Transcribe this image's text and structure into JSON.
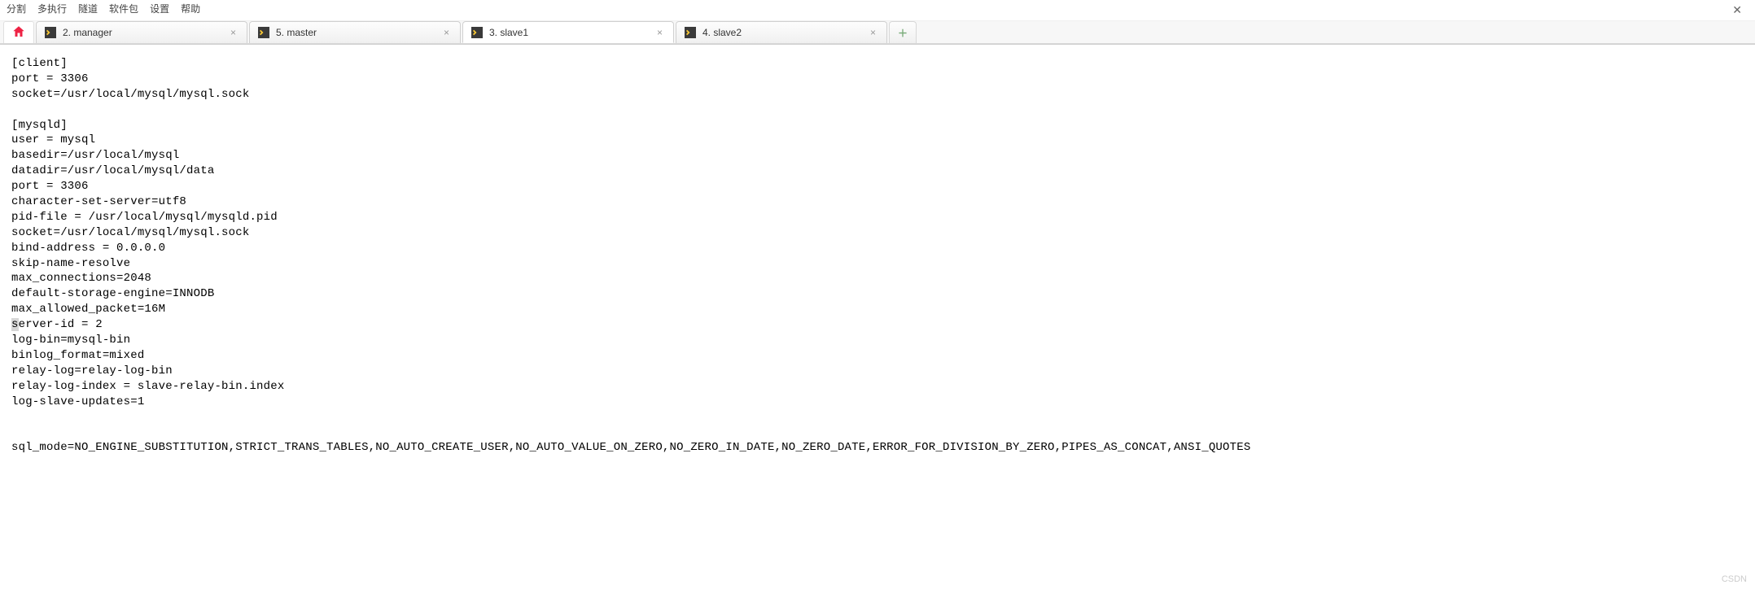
{
  "menu": {
    "items": [
      "分割",
      "多执行",
      "隧道",
      "软件包",
      "设置",
      "帮助"
    ]
  },
  "tabs": [
    {
      "label": "2. manager",
      "active": false
    },
    {
      "label": "5. master",
      "active": false
    },
    {
      "label": "3. slave1",
      "active": true
    },
    {
      "label": "4. slave2",
      "active": false
    }
  ],
  "editor": {
    "lines": [
      "[client]",
      "port = 3306",
      "socket=/usr/local/mysql/mysql.sock",
      "",
      "[mysqld]",
      "user = mysql",
      "basedir=/usr/local/mysql",
      "datadir=/usr/local/mysql/data",
      "port = 3306",
      "character-set-server=utf8",
      "pid-file = /usr/local/mysql/mysqld.pid",
      "socket=/usr/local/mysql/mysql.sock",
      "bind-address = 0.0.0.0",
      "skip-name-resolve",
      "max_connections=2048",
      "default-storage-engine=INNODB",
      "max_allowed_packet=16M",
      "server-id = 2",
      "log-bin=mysql-bin",
      "binlog_format=mixed",
      "relay-log=relay-log-bin",
      "relay-log-index = slave-relay-bin.index",
      "log-slave-updates=1",
      "",
      "",
      "sql_mode=NO_ENGINE_SUBSTITUTION,STRICT_TRANS_TABLES,NO_AUTO_CREATE_USER,NO_AUTO_VALUE_ON_ZERO,NO_ZERO_IN_DATE,NO_ZERO_DATE,ERROR_FOR_DIVISION_BY_ZERO,PIPES_AS_CONCAT,ANSI_QUOTES"
    ],
    "cursor_line_index": 17,
    "cursor_col": 0
  },
  "watermark": "CSDN"
}
